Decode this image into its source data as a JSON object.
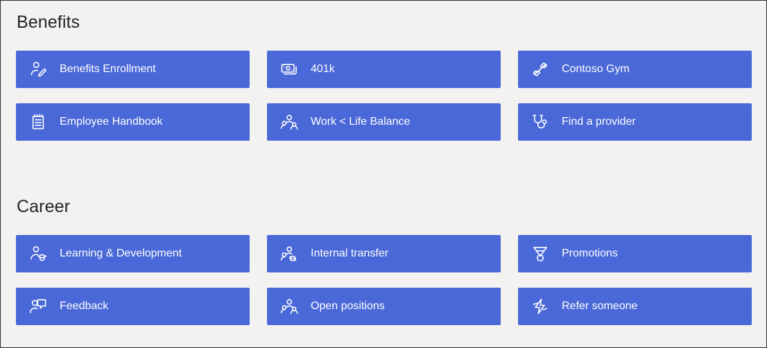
{
  "theme": {
    "page_background": "#f3f2f1",
    "tile_background": "#4a68d7",
    "tile_text": "#ffffff",
    "heading_text": "#242424",
    "frame_border": "#2b2b2b"
  },
  "sections": [
    {
      "id": "benefits",
      "title": "Benefits",
      "tiles": [
        {
          "label": "Benefits Enrollment",
          "icon": "person-edit-icon"
        },
        {
          "label": "401k",
          "icon": "money-banknote-icon"
        },
        {
          "label": "Contoso Gym",
          "icon": "dumbbell-icon"
        },
        {
          "label": "Employee Handbook",
          "icon": "notepad-icon"
        },
        {
          "label": "Work < Life Balance",
          "icon": "people-group-icon"
        },
        {
          "label": "Find a provider",
          "icon": "stethoscope-icon"
        }
      ]
    },
    {
      "id": "career",
      "title": "Career",
      "tiles": [
        {
          "label": "Learning & Development",
          "icon": "person-graduation-icon"
        },
        {
          "label": "Internal transfer",
          "icon": "people-sync-icon"
        },
        {
          "label": "Promotions",
          "icon": "medal-icon"
        },
        {
          "label": "Feedback",
          "icon": "person-feedback-icon"
        },
        {
          "label": "Open positions",
          "icon": "people-group-icon"
        },
        {
          "label": "Refer someone",
          "icon": "lightning-bolt-icon"
        }
      ]
    }
  ]
}
